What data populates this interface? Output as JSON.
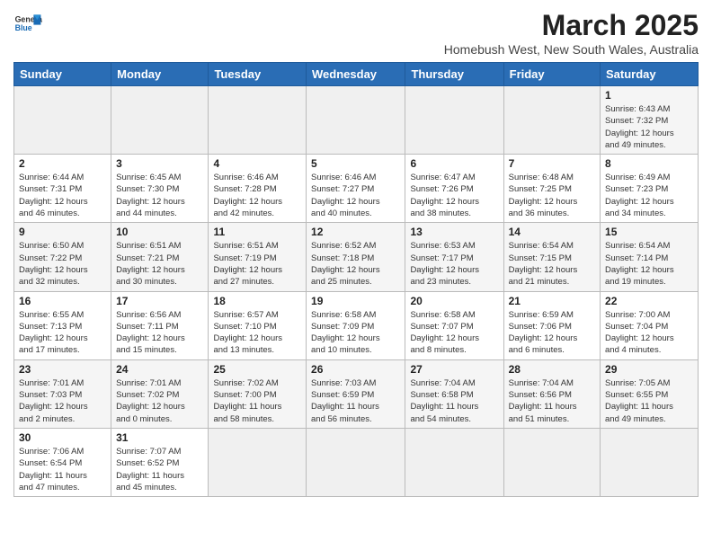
{
  "header": {
    "logo_general": "General",
    "logo_blue": "Blue",
    "title": "March 2025",
    "subtitle": "Homebush West, New South Wales, Australia"
  },
  "days_of_week": [
    "Sunday",
    "Monday",
    "Tuesday",
    "Wednesday",
    "Thursday",
    "Friday",
    "Saturday"
  ],
  "weeks": [
    [
      {
        "day": "",
        "info": ""
      },
      {
        "day": "",
        "info": ""
      },
      {
        "day": "",
        "info": ""
      },
      {
        "day": "",
        "info": ""
      },
      {
        "day": "",
        "info": ""
      },
      {
        "day": "",
        "info": ""
      },
      {
        "day": "1",
        "info": "Sunrise: 6:43 AM\nSunset: 7:32 PM\nDaylight: 12 hours\nand 49 minutes."
      }
    ],
    [
      {
        "day": "2",
        "info": "Sunrise: 6:44 AM\nSunset: 7:31 PM\nDaylight: 12 hours\nand 46 minutes."
      },
      {
        "day": "3",
        "info": "Sunrise: 6:45 AM\nSunset: 7:30 PM\nDaylight: 12 hours\nand 44 minutes."
      },
      {
        "day": "4",
        "info": "Sunrise: 6:46 AM\nSunset: 7:28 PM\nDaylight: 12 hours\nand 42 minutes."
      },
      {
        "day": "5",
        "info": "Sunrise: 6:46 AM\nSunset: 7:27 PM\nDaylight: 12 hours\nand 40 minutes."
      },
      {
        "day": "6",
        "info": "Sunrise: 6:47 AM\nSunset: 7:26 PM\nDaylight: 12 hours\nand 38 minutes."
      },
      {
        "day": "7",
        "info": "Sunrise: 6:48 AM\nSunset: 7:25 PM\nDaylight: 12 hours\nand 36 minutes."
      },
      {
        "day": "8",
        "info": "Sunrise: 6:49 AM\nSunset: 7:23 PM\nDaylight: 12 hours\nand 34 minutes."
      }
    ],
    [
      {
        "day": "9",
        "info": "Sunrise: 6:50 AM\nSunset: 7:22 PM\nDaylight: 12 hours\nand 32 minutes."
      },
      {
        "day": "10",
        "info": "Sunrise: 6:51 AM\nSunset: 7:21 PM\nDaylight: 12 hours\nand 30 minutes."
      },
      {
        "day": "11",
        "info": "Sunrise: 6:51 AM\nSunset: 7:19 PM\nDaylight: 12 hours\nand 27 minutes."
      },
      {
        "day": "12",
        "info": "Sunrise: 6:52 AM\nSunset: 7:18 PM\nDaylight: 12 hours\nand 25 minutes."
      },
      {
        "day": "13",
        "info": "Sunrise: 6:53 AM\nSunset: 7:17 PM\nDaylight: 12 hours\nand 23 minutes."
      },
      {
        "day": "14",
        "info": "Sunrise: 6:54 AM\nSunset: 7:15 PM\nDaylight: 12 hours\nand 21 minutes."
      },
      {
        "day": "15",
        "info": "Sunrise: 6:54 AM\nSunset: 7:14 PM\nDaylight: 12 hours\nand 19 minutes."
      }
    ],
    [
      {
        "day": "16",
        "info": "Sunrise: 6:55 AM\nSunset: 7:13 PM\nDaylight: 12 hours\nand 17 minutes."
      },
      {
        "day": "17",
        "info": "Sunrise: 6:56 AM\nSunset: 7:11 PM\nDaylight: 12 hours\nand 15 minutes."
      },
      {
        "day": "18",
        "info": "Sunrise: 6:57 AM\nSunset: 7:10 PM\nDaylight: 12 hours\nand 13 minutes."
      },
      {
        "day": "19",
        "info": "Sunrise: 6:58 AM\nSunset: 7:09 PM\nDaylight: 12 hours\nand 10 minutes."
      },
      {
        "day": "20",
        "info": "Sunrise: 6:58 AM\nSunset: 7:07 PM\nDaylight: 12 hours\nand 8 minutes."
      },
      {
        "day": "21",
        "info": "Sunrise: 6:59 AM\nSunset: 7:06 PM\nDaylight: 12 hours\nand 6 minutes."
      },
      {
        "day": "22",
        "info": "Sunrise: 7:00 AM\nSunset: 7:04 PM\nDaylight: 12 hours\nand 4 minutes."
      }
    ],
    [
      {
        "day": "23",
        "info": "Sunrise: 7:01 AM\nSunset: 7:03 PM\nDaylight: 12 hours\nand 2 minutes."
      },
      {
        "day": "24",
        "info": "Sunrise: 7:01 AM\nSunset: 7:02 PM\nDaylight: 12 hours\nand 0 minutes."
      },
      {
        "day": "25",
        "info": "Sunrise: 7:02 AM\nSunset: 7:00 PM\nDaylight: 11 hours\nand 58 minutes."
      },
      {
        "day": "26",
        "info": "Sunrise: 7:03 AM\nSunset: 6:59 PM\nDaylight: 11 hours\nand 56 minutes."
      },
      {
        "day": "27",
        "info": "Sunrise: 7:04 AM\nSunset: 6:58 PM\nDaylight: 11 hours\nand 54 minutes."
      },
      {
        "day": "28",
        "info": "Sunrise: 7:04 AM\nSunset: 6:56 PM\nDaylight: 11 hours\nand 51 minutes."
      },
      {
        "day": "29",
        "info": "Sunrise: 7:05 AM\nSunset: 6:55 PM\nDaylight: 11 hours\nand 49 minutes."
      }
    ],
    [
      {
        "day": "30",
        "info": "Sunrise: 7:06 AM\nSunset: 6:54 PM\nDaylight: 11 hours\nand 47 minutes."
      },
      {
        "day": "31",
        "info": "Sunrise: 7:07 AM\nSunset: 6:52 PM\nDaylight: 11 hours\nand 45 minutes."
      },
      {
        "day": "",
        "info": ""
      },
      {
        "day": "",
        "info": ""
      },
      {
        "day": "",
        "info": ""
      },
      {
        "day": "",
        "info": ""
      },
      {
        "day": "",
        "info": ""
      }
    ]
  ]
}
